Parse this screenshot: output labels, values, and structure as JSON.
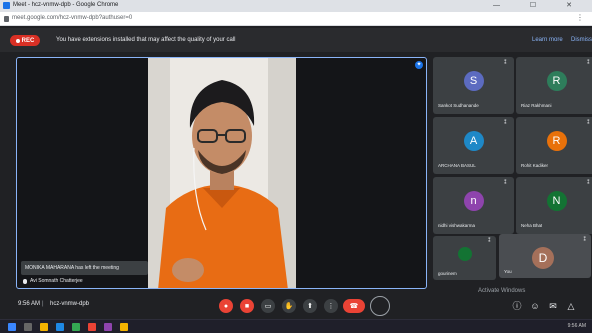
{
  "browser": {
    "tab_title": "Meet - hcz-vnmw-dpb - Google Chrome",
    "url": "meet.google.com/hcz-vnmw-dpb?authuser=0",
    "window_controls": "— ☐ ✕"
  },
  "infobar": {
    "rec_label": "REC",
    "message": "You have extensions installed that may affect the quality of your call",
    "learn_more": "Learn more",
    "dismiss": "Dismiss"
  },
  "presenter": {
    "toast": "MONIKA MAHARANA has left the meeting",
    "name": "Avi Somnath Chatterjee"
  },
  "participants": [
    {
      "initial": "S",
      "name": "Sankot Sudhanande",
      "color": "#5c6bc0"
    },
    {
      "initial": "R",
      "name": "Riaz Rakhmani",
      "color": "#2e7d5b"
    },
    {
      "initial": "A",
      "name": "ARCHANA BASUL",
      "color": "#1e88c7"
    },
    {
      "initial": "R",
      "name": "Rohit Kadiker",
      "color": "#e8710a"
    },
    {
      "initial": "n",
      "name": "nidhi vishwakarma",
      "color": "#8e44ad"
    },
    {
      "initial": "N",
      "name": "Neha Bhat",
      "color": "#137333"
    }
  ],
  "small_tile": {
    "name": "gourinem"
  },
  "self_tile": {
    "initial": "D",
    "name": "You"
  },
  "watermark": "Activate Windows",
  "bottombar": {
    "time": "9:56 AM",
    "separator": "|",
    "meeting_code": "hcz-vnmw-dpb"
  },
  "taskbar": {
    "time": "9:56 AM"
  }
}
